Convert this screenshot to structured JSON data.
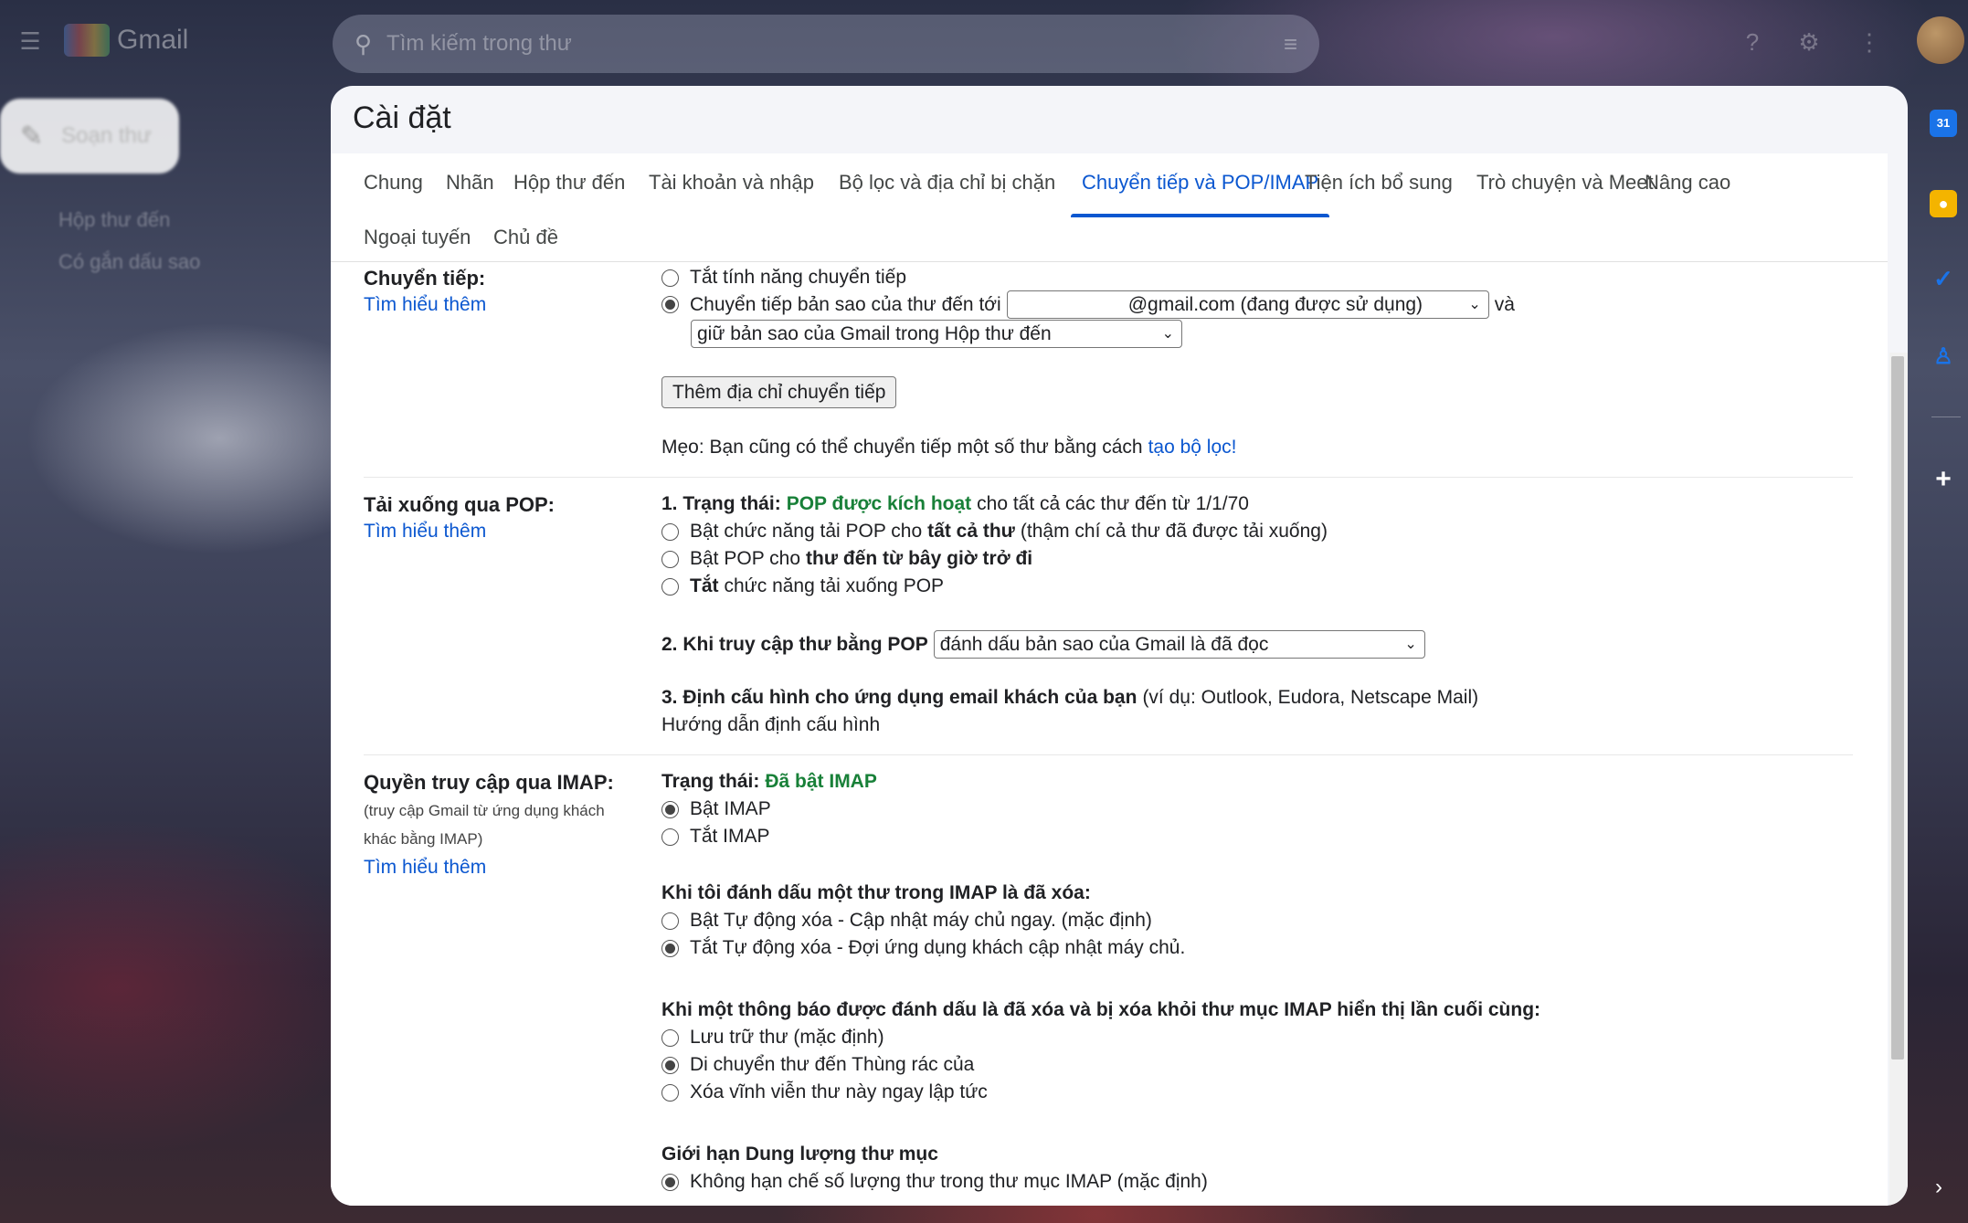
{
  "app": {
    "logo_text": "Gmail",
    "search_placeholder": "Tìm kiếm trong thư"
  },
  "sidebar": {
    "compose": "Soạn thư",
    "items": [
      "Hộp thư đến",
      "Có gắn dấu sao"
    ]
  },
  "settings": {
    "title": "Cài đặt",
    "tabs": [
      "Chung",
      "Nhãn",
      "Hộp thư đến",
      "Tài khoản và nhập",
      "Bộ lọc và địa chỉ bị chặn",
      "Chuyển tiếp và POP/IMAP",
      "Tiện ích bổ sung",
      "Trò chuyện và Meet",
      "Nâng cao",
      "Ngoại tuyến",
      "Chủ đề"
    ],
    "active_tab": "Chuyển tiếp và POP/IMAP",
    "learn_more": "Tìm hiểu thêm",
    "forwarding": {
      "label": "Chuyển tiếp:",
      "opt_off": "Tắt tính năng chuyển tiếp",
      "opt_on": "Chuyển tiếp bản sao của thư đến tới",
      "address_select": "@gmail.com (đang được sử dụng)",
      "and": "và",
      "action_select": "giữ bản sao của Gmail trong Hộp thư đến",
      "add_button": "Thêm địa chỉ chuyển tiếp",
      "tip": "Mẹo: Bạn cũng có thể chuyển tiếp một số thư bằng cách",
      "tip_link": "tạo bộ lọc!"
    },
    "pop": {
      "label": "Tải xuống qua POP:",
      "status_prefix": "1. Trạng thái:",
      "status_value": "POP được kích hoạt",
      "status_suffix": "cho tất cả các thư đến từ 1/1/70",
      "opt1_a": "Bật chức năng tải POP cho",
      "opt1_b": "tất cả thư",
      "opt1_c": "(thậm chí cả thư đã được tải xuống)",
      "opt2_a": "Bật POP cho",
      "opt2_b": "thư đến từ bây giờ trở đi",
      "opt3_a": "Tắt",
      "opt3_b": "chức năng tải xuống POP",
      "access_label": "2. Khi truy cập thư bằng POP",
      "access_select": "đánh dấu bản sao của Gmail là đã đọc",
      "config_label": "3. Định cấu hình cho ứng dụng email khách của bạn",
      "config_example": "(ví dụ: Outlook, Eudora, Netscape Mail)",
      "config_link": "Hướng dẫn định cấu hình"
    },
    "imap": {
      "label": "Quyền truy cập qua IMAP:",
      "sub": "(truy cập Gmail từ ứng dụng khách khác bằng IMAP)",
      "status_prefix": "Trạng thái:",
      "status_value": "Đã bật IMAP",
      "on": "Bật IMAP",
      "off": "Tắt IMAP",
      "delete_heading": "Khi tôi đánh dấu một thư trong IMAP là đã xóa:",
      "auto_on": "Bật Tự động xóa - Cập nhật máy chủ ngay. (mặc định)",
      "auto_off": "Tắt Tự động xóa - Đợi ứng dụng khách cập nhật máy chủ.",
      "expunge_heading": "Khi một thông báo được đánh dấu là đã xóa và bị xóa khỏi thư mục IMAP hiển thị lần cuối cùng:",
      "archive": "Lưu trữ thư (mặc định)",
      "trash": "Di chuyển thư đến Thùng rác của",
      "delete": "Xóa vĩnh viễn thư này ngay lập tức",
      "limit_heading": "Giới hạn Dung lượng thư mục",
      "no_limit": "Không hạn chế số lượng thư trong thư mục IMAP (mặc định)"
    }
  },
  "colors": {
    "accent": "#0b57d0",
    "status_green": "#188038"
  }
}
